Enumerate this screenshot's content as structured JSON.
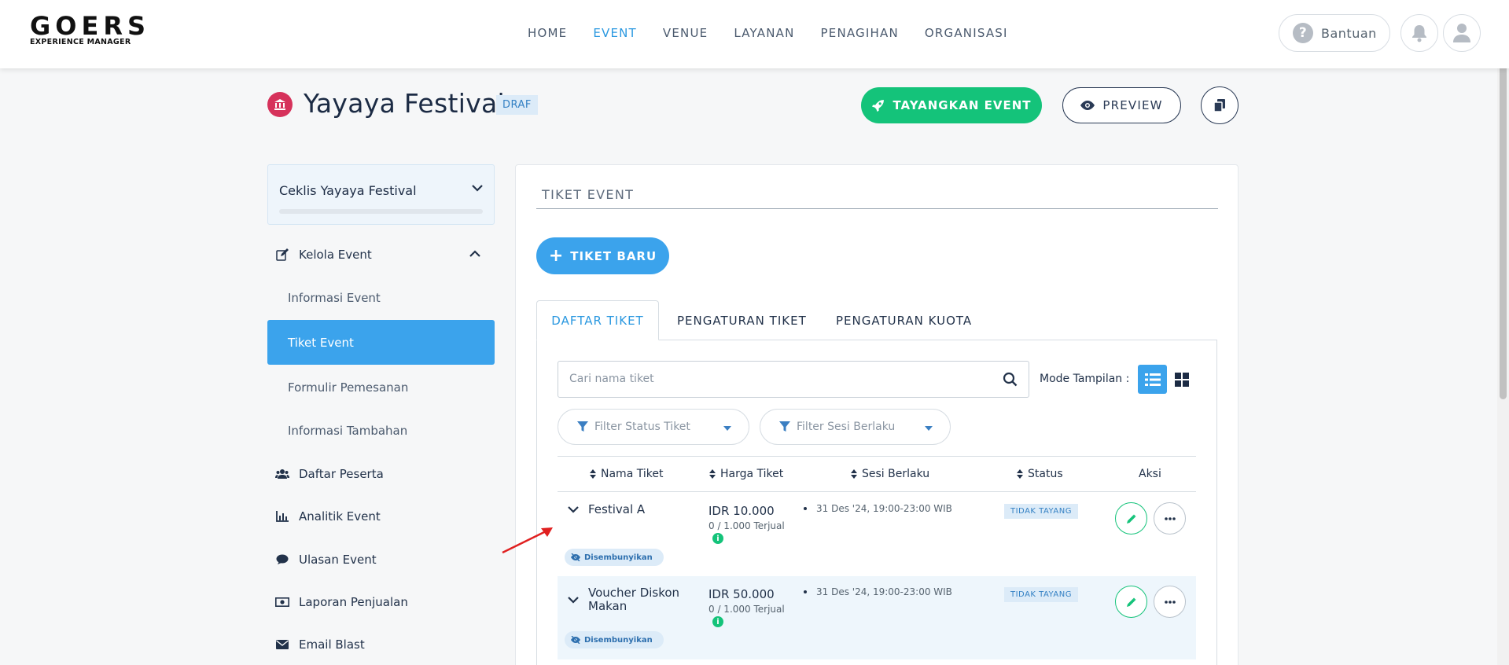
{
  "brand": {
    "line1": "GOERS",
    "line2": "EXPERIENCE MANAGER"
  },
  "nav": {
    "items": [
      {
        "label": "HOME",
        "active": false
      },
      {
        "label": "EVENT",
        "active": true
      },
      {
        "label": "VENUE",
        "active": false
      },
      {
        "label": "LAYANAN",
        "active": false
      },
      {
        "label": "PENAGIHAN",
        "active": false
      },
      {
        "label": "ORGANISASI",
        "active": false
      }
    ],
    "help_label": "Bantuan"
  },
  "event": {
    "title": "Yayaya Festival",
    "status_badge": "DRAF",
    "publish_label": "TAYANGKAN EVENT",
    "preview_label": "PREVIEW"
  },
  "sidebar": {
    "checklist_title": "Ceklis Yayaya Festival",
    "manage_label": "Kelola Event",
    "sub_items": [
      "Informasi Event",
      "Tiket Event",
      "Formulir Pemesanan",
      "Informasi Tambahan"
    ],
    "active_sub": "Tiket Event",
    "items": [
      "Daftar Peserta",
      "Analitik Event",
      "Ulasan Event",
      "Laporan Penjualan",
      "Email Blast"
    ]
  },
  "main": {
    "section_title": "TIKET EVENT",
    "new_ticket_label": "TIKET BARU",
    "tabs": [
      "DAFTAR TIKET",
      "PENGATURAN TIKET",
      "PENGATURAN KUOTA"
    ],
    "search_placeholder": "Cari nama tiket",
    "mode_label": "Mode Tampilan :",
    "filters": [
      "Filter Status Tiket",
      "Filter Sesi Berlaku"
    ],
    "columns": [
      "Nama Tiket",
      "Harga Tiket",
      "Sesi Berlaku",
      "Status",
      "Aksi"
    ],
    "rows": [
      {
        "name_line1": "Festival A",
        "name_line2": "",
        "price": "IDR 10.000",
        "sold": "0 / 1.000 Terjual",
        "session": "31 Des '24, 19:00-23:00 WIB",
        "status": "TIDAK TAYANG",
        "visibility": "Disembunyikan"
      },
      {
        "name_line1": "Voucher Diskon",
        "name_line2": "Makan",
        "price": "IDR 50.000",
        "sold": "0 / 1.000 Terjual",
        "session": "31 Des '24, 19:00-23:00 WIB",
        "status": "TIDAK TAYANG",
        "visibility": "Disembunyikan"
      }
    ]
  },
  "colors": {
    "accent": "#3ba3ec",
    "publish": "#14c37a",
    "event_icon": "#d6325b",
    "annotation_arrow": "#e02020"
  }
}
